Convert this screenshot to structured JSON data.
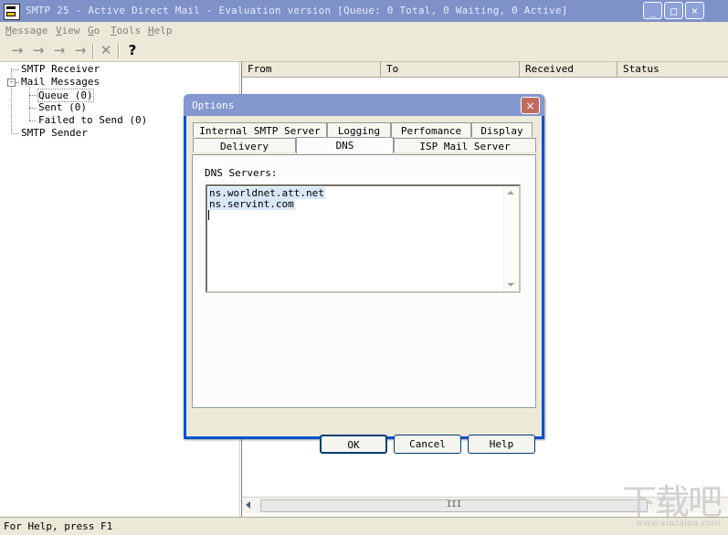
{
  "window": {
    "title": "SMTP 25 - Active Direct Mail - Evaluation version [Queue:     0 Total, 0 Waiting, 0 Active]",
    "controls": {
      "minimize": "_",
      "maximize": "□",
      "close": "×"
    }
  },
  "menubar": {
    "items": [
      {
        "hot": "M",
        "rest": "essage"
      },
      {
        "hot": "V",
        "rest": "iew"
      },
      {
        "hot": "G",
        "rest": "o"
      },
      {
        "hot": "T",
        "rest": "ools"
      },
      {
        "hot": "H",
        "rest": "elp"
      }
    ]
  },
  "toolbar": {
    "buttons": [
      "→",
      "→",
      "→",
      "→",
      "✕",
      "?"
    ]
  },
  "tree": {
    "smtp_receiver": "SMTP Receiver",
    "mail_messages": "Mail Messages",
    "queue": "Queue (0)",
    "sent": "Sent (0)",
    "failed": "Failed to Send (0)",
    "smtp_sender": "SMTP Sender",
    "expander": "-"
  },
  "list": {
    "columns": [
      "From",
      "To",
      "Received",
      "Status"
    ],
    "scroll_grip": "III"
  },
  "statusbar": {
    "text": "For Help, press F1"
  },
  "dialog": {
    "title": "Options",
    "close": "×",
    "tabs_row1": [
      "Internal SMTP Server",
      "Logging",
      "Perfomance",
      "Display"
    ],
    "tabs_row2": [
      "Delivery",
      "DNS",
      "ISP Mail Server"
    ],
    "dns_label": "DNS Servers:",
    "dns_servers": [
      "ns.worldnet.att.net",
      "ns.servint.com"
    ],
    "buttons": {
      "ok": "OK",
      "cancel": "Cancel",
      "help": "Help"
    }
  },
  "watermark": {
    "logo": "下载吧",
    "url": "www.xiazaiba.com"
  }
}
